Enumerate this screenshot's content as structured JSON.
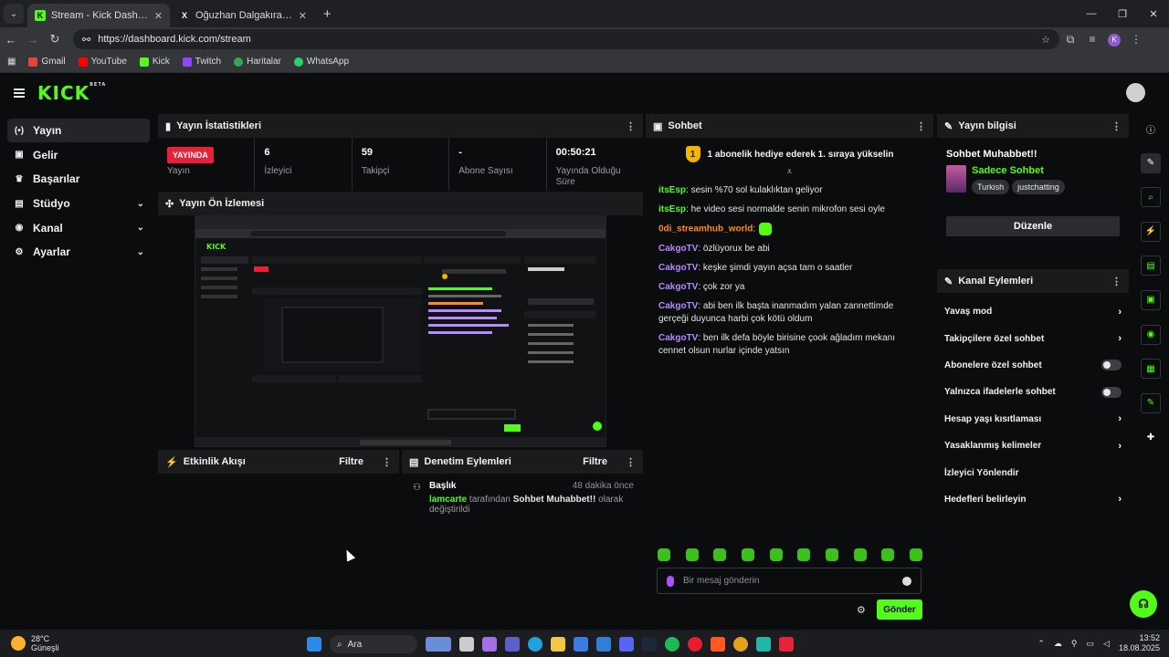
{
  "browser": {
    "tabs": [
      {
        "title": "Stream - Kick Dashboard",
        "fav": "K"
      },
      {
        "title": "Oğuzhan Dalgakıran on X: \"#FO",
        "fav": "X"
      }
    ],
    "url": "https://dashboard.kick.com/stream",
    "profile_initial": "K",
    "bookmarks": [
      "Gmail",
      "YouTube",
      "Kick",
      "Twitch",
      "Haritalar",
      "WhatsApp"
    ]
  },
  "kick": {
    "logo": "KICK",
    "logo_badge": "BETA"
  },
  "nav": [
    {
      "label": "Yayın",
      "icon": "(•)"
    },
    {
      "label": "Gelir",
      "icon": "▣"
    },
    {
      "label": "Başarılar",
      "icon": "♛"
    },
    {
      "label": "Stüdyo",
      "icon": "▤"
    },
    {
      "label": "Kanal",
      "icon": "◉"
    },
    {
      "label": "Ayarlar",
      "icon": "⚙"
    }
  ],
  "stats": {
    "title": "Yayın İstatistikleri",
    "live_badge": "YAYINDA",
    "live_label": "Yayın",
    "viewers": "6",
    "viewers_label": "İzleyici",
    "followers": "59",
    "followers_label": "Takipçi",
    "subs": "-",
    "subs_label": "Abone Sayısı",
    "uptime": "00:50:21",
    "uptime_label": "Yayında Olduğu Süre"
  },
  "preview": {
    "title": "Yayın Ön İzlemesi"
  },
  "activity": {
    "title": "Etkinlik Akışı",
    "filter": "Filtre"
  },
  "moderation": {
    "title": "Denetim Eylemleri",
    "filter": "Filtre",
    "entry_title": "Başlık",
    "entry_ago": "48 dakika önce",
    "entry_user": "lamcarte",
    "entry_by": "tarafından",
    "entry_value": "Sohbet Muhabbet!!",
    "entry_suffix": "olarak değiştirildi"
  },
  "chat": {
    "title": "Sohbet",
    "banner_rank": "1",
    "banner": "1 abonelik hediye ederek 1. sıraya yükselin",
    "messages": [
      {
        "user": "itsEsp",
        "color": "#53fc18",
        "text": ": sesin %70 sol kulaklıktan geliyor"
      },
      {
        "user": "itsEsp",
        "color": "#53fc18",
        "text": ": he video sesi normalde senin mikrofon sesi oyle"
      },
      {
        "user": "0di_streamhub_world",
        "color": "#ff8a1c",
        "text": ":"
      },
      {
        "user": "CakgoTV",
        "color": "#b48cff",
        "text": ": özlüyorux be abi"
      },
      {
        "user": "CakgoTV",
        "color": "#b48cff",
        "text": ": keşke şimdi yayın açsa tam o saatler"
      },
      {
        "user": "CakgoTV",
        "color": "#b48cff",
        "text": ": çok zor ya"
      },
      {
        "user": "CakgoTV",
        "color": "#b48cff",
        "text": ": abi ben ilk başta inanmadım yalan zannettimde gerçeği duyunca harbi çok kötü oldum"
      },
      {
        "user": "CakgoTV",
        "color": "#b48cff",
        "text": ": ben ilk defa böyle birisine çook ağladım mekanı cennet olsun nurlar içinde yatsın"
      }
    ],
    "placeholder": "Bir mesaj gönderin",
    "send": "Gönder"
  },
  "stream_info": {
    "title": "Yayın bilgisi",
    "stream_title": "Sohbet Muhabbet!!",
    "category": "Sadece Sohbet",
    "tags": [
      "Turkish",
      "justchatting"
    ],
    "edit": "Düzenle"
  },
  "channel_actions": {
    "title": "Kanal Eylemleri",
    "items": [
      {
        "label": "Yavaş mod",
        "kind": "chevron"
      },
      {
        "label": "Takipçilere özel sohbet",
        "kind": "chevron"
      },
      {
        "label": "Abonelere özel sohbet",
        "kind": "toggle"
      },
      {
        "label": "Yalnızca ifadelerle sohbet",
        "kind": "toggle"
      },
      {
        "label": "Hesap yaşı kısıtlaması",
        "kind": "chevron"
      },
      {
        "label": "Yasaklanmış kelimeler",
        "kind": "chevron"
      },
      {
        "label": "İzleyici Yönlendir",
        "kind": "none"
      },
      {
        "label": "Hedefleri belirleyin",
        "kind": "chevron"
      }
    ]
  },
  "taskbar": {
    "temp": "28°C",
    "weather": "Güneşli",
    "search": "Ara",
    "time": "13:52",
    "date": "18.08.2025"
  },
  "colors": {
    "accent": "#53fc18",
    "live": "#e8203a",
    "panel": "#191b1d"
  }
}
